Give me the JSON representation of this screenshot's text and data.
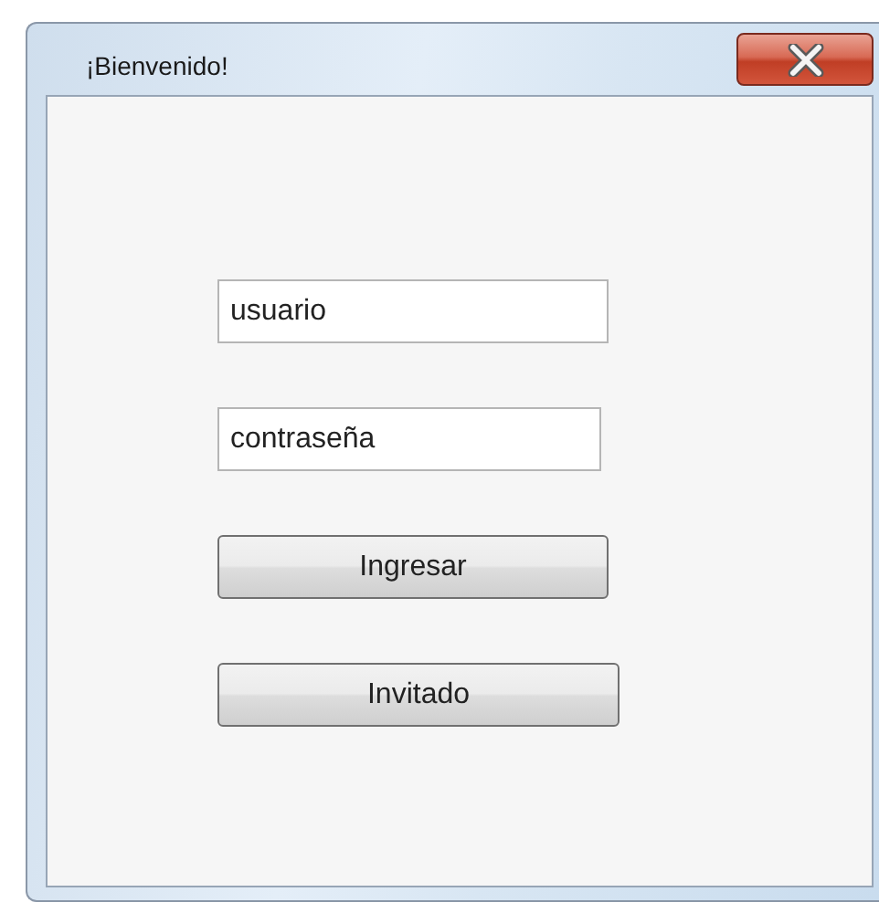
{
  "window": {
    "title": "¡Bienvenido!"
  },
  "fields": [
    {
      "value": "usuario"
    },
    {
      "value": "contraseña"
    }
  ],
  "buttons": [
    "Ingresar",
    "Invitado"
  ]
}
